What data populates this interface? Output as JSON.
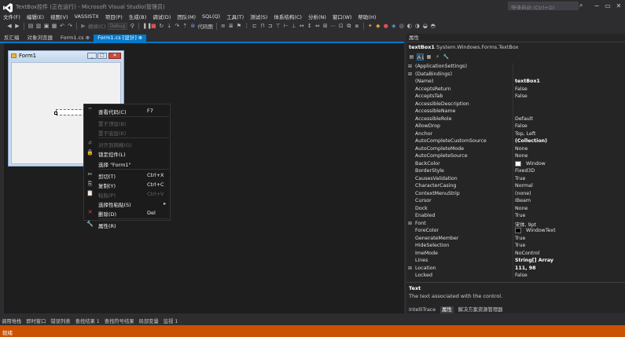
{
  "window": {
    "title": "TextBox控件 (正在运行) - Microsoft Visual Studio(管理员)",
    "quick_launch_placeholder": "快速启动 (Ctrl+Q)"
  },
  "menu": [
    "文件(F)",
    "编辑(E)",
    "视图(V)",
    "VASSISTX",
    "项目(P)",
    "生成(B)",
    "调试(D)",
    "团队(M)",
    "SQL(Q)",
    "工具(T)",
    "测试(S)",
    "体系结构(C)",
    "分析(N)",
    "窗口(W)",
    "帮助(H)"
  ],
  "toolbar": {
    "continue_label": "继续(C)",
    "config": "Debug",
    "code_map_label": "代码图"
  },
  "doc_tabs": [
    {
      "label": "反汇编",
      "active": false
    },
    {
      "label": "对象浏览器",
      "active": false
    },
    {
      "label": "Form1.cs ⊕",
      "active": false
    },
    {
      "label": "Form1.cs [设计] ⊕",
      "active": true
    }
  ],
  "form": {
    "caption": "Form1"
  },
  "context_menu": [
    {
      "icon": "⌔",
      "label": "查看代码(C)",
      "key": "F7",
      "disabled": false
    },
    {
      "sep": true
    },
    {
      "icon": "",
      "label": "置于顶层(B)",
      "key": "",
      "disabled": true
    },
    {
      "icon": "",
      "label": "置于底层(K)",
      "key": "",
      "disabled": true
    },
    {
      "sep": true
    },
    {
      "icon": "#",
      "label": "对齐到网格(G)",
      "key": "",
      "disabled": true
    },
    {
      "icon": "🔒",
      "label": "锁定控件(L)",
      "key": "",
      "disabled": false
    },
    {
      "icon": "",
      "label": "选择 \"Form1\"",
      "key": "",
      "disabled": false
    },
    {
      "sep": true
    },
    {
      "icon": "✂",
      "label": "剪切(T)",
      "key": "Ctrl+X",
      "disabled": false
    },
    {
      "icon": "⎘",
      "label": "复制(Y)",
      "key": "Ctrl+C",
      "disabled": false
    },
    {
      "icon": "📋",
      "label": "粘贴(P)",
      "key": "Ctrl+V",
      "disabled": true
    },
    {
      "icon": "",
      "label": "选择性粘贴(S)",
      "key": "",
      "disabled": false,
      "submenu": true
    },
    {
      "icon": "✕",
      "label": "删除(D)",
      "key": "Del",
      "disabled": false,
      "red": true
    },
    {
      "sep": true
    },
    {
      "icon": "🔧",
      "label": "属性(R)",
      "key": "",
      "disabled": false
    }
  ],
  "properties": {
    "header": "属性",
    "object_name": "textBox1",
    "object_type": "System.Windows.Forms.TextBox",
    "rows": [
      {
        "name": "(ApplicationSettings)",
        "value": "",
        "expand": "⊞"
      },
      {
        "name": "(DataBindings)",
        "value": "",
        "expand": "⊞"
      },
      {
        "name": "(Name)",
        "value": "textBox1",
        "bold": true
      },
      {
        "name": "AcceptsReturn",
        "value": "False"
      },
      {
        "name": "AcceptsTab",
        "value": "False"
      },
      {
        "name": "AccessibleDescription",
        "value": ""
      },
      {
        "name": "AccessibleName",
        "value": ""
      },
      {
        "name": "AccessibleRole",
        "value": "Default"
      },
      {
        "name": "AllowDrop",
        "value": "False"
      },
      {
        "name": "Anchor",
        "value": "Top, Left"
      },
      {
        "name": "AutoCompleteCustomSource",
        "value": "(Collection)",
        "bold": true
      },
      {
        "name": "AutoCompleteMode",
        "value": "None"
      },
      {
        "name": "AutoCompleteSource",
        "value": "None"
      },
      {
        "name": "BackColor",
        "value": "Window",
        "swatch": "#ffffff"
      },
      {
        "name": "BorderStyle",
        "value": "Fixed3D"
      },
      {
        "name": "CausesValidation",
        "value": "True"
      },
      {
        "name": "CharacterCasing",
        "value": "Normal"
      },
      {
        "name": "ContextMenuStrip",
        "value": "(none)"
      },
      {
        "name": "Cursor",
        "value": "IBeam"
      },
      {
        "name": "Dock",
        "value": "None"
      },
      {
        "name": "Enabled",
        "value": "True"
      },
      {
        "name": "Font",
        "value": "宋体, 9pt",
        "expand": "⊞"
      },
      {
        "name": "ForeColor",
        "value": "WindowText",
        "swatch": "#000000"
      },
      {
        "name": "GenerateMember",
        "value": "True"
      },
      {
        "name": "HideSelection",
        "value": "True"
      },
      {
        "name": "ImeMode",
        "value": "NoControl"
      },
      {
        "name": "Lines",
        "value": "String[] Array",
        "bold": true
      },
      {
        "name": "Location",
        "value": "111, 98",
        "bold": true,
        "expand": "⊞"
      },
      {
        "name": "Locked",
        "value": "False"
      }
    ],
    "desc_title": "Text",
    "desc_text": "The text associated with the control."
  },
  "right_bottom_tabs": [
    {
      "label": "IntelliTrace",
      "active": false
    },
    {
      "label": "属性",
      "active": true
    },
    {
      "label": "解决方案资源管理器",
      "active": false
    }
  ],
  "bottom_tabs": [
    "调用堆栈",
    "即时窗口",
    "错误列表",
    "查找结果 1",
    "查找符号结果",
    "局部变量",
    "监视 1"
  ],
  "status": {
    "text": "就绪"
  },
  "colors": {
    "accent": "#007acc",
    "status_bar": "#ca5100"
  }
}
